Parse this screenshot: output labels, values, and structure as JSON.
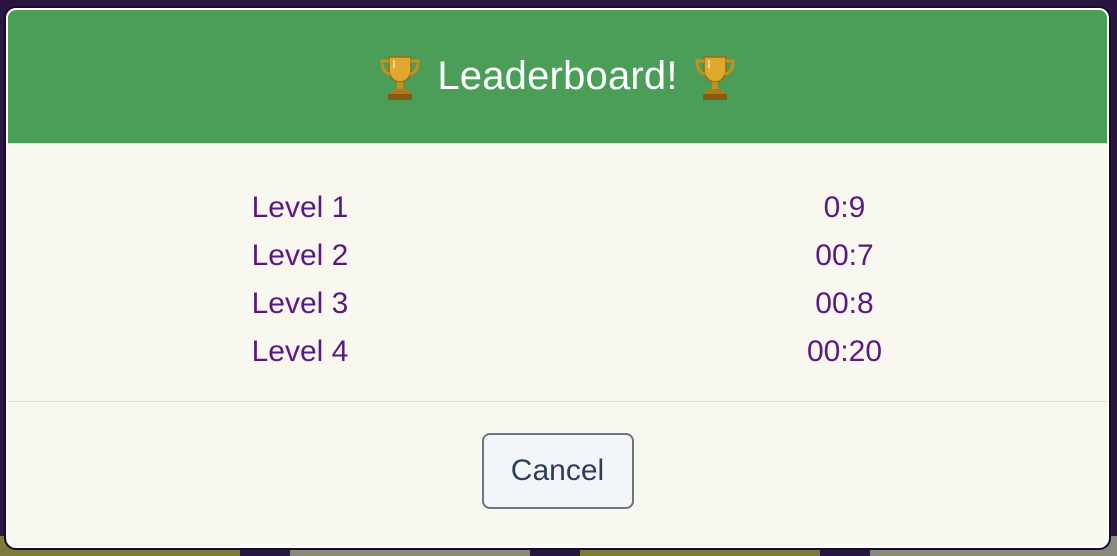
{
  "modal": {
    "title": "Leaderboard!",
    "title_icon": "trophy-icon",
    "colors": {
      "header_bg": "#4a9e58",
      "body_bg": "#f9f8f0",
      "score_text": "#5a1a82",
      "button_text": "#2b3f5c"
    }
  },
  "scores": [
    {
      "level": "Level 1",
      "time": "0:9"
    },
    {
      "level": "Level 2",
      "time": "00:7"
    },
    {
      "level": "Level 3",
      "time": "00:8"
    },
    {
      "level": "Level 4",
      "time": "00:20"
    }
  ],
  "footer": {
    "cancel_label": "Cancel"
  }
}
